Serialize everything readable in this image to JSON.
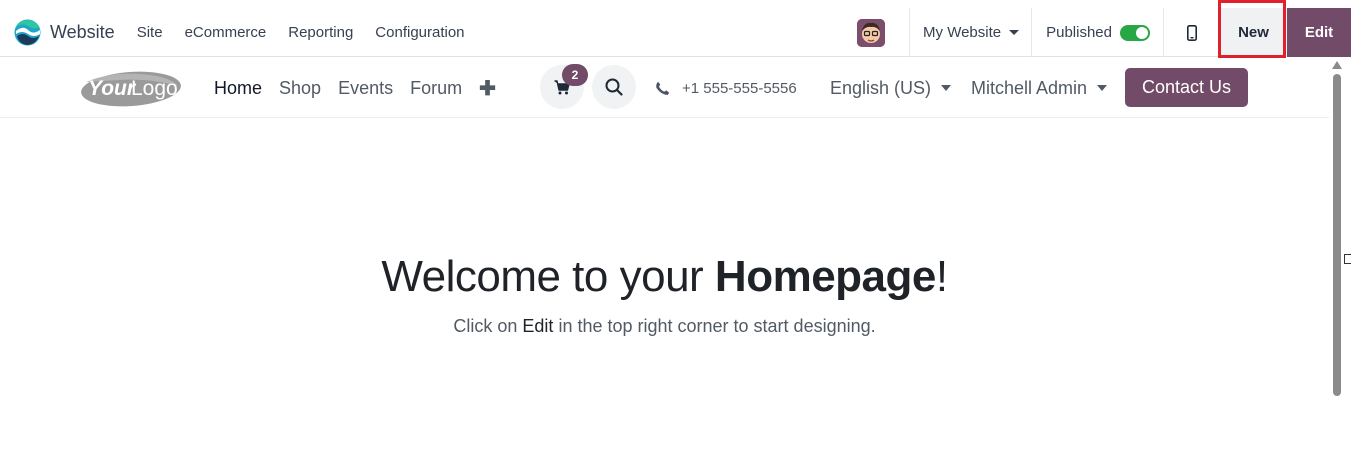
{
  "topbar": {
    "app_name": "Website",
    "menu": [
      "Site",
      "eCommerce",
      "Reporting",
      "Configuration"
    ],
    "website_selector": "My Website",
    "published_label": "Published",
    "published": true,
    "new_label": "New",
    "edit_label": "Edit"
  },
  "site_header": {
    "nav": [
      "Home",
      "Shop",
      "Events",
      "Forum"
    ],
    "active_nav": "Home",
    "cart_count": "2",
    "phone": "+1 555-555-5556",
    "language": "English (US)",
    "user": "Mitchell Admin",
    "contact_label": "Contact Us"
  },
  "hero": {
    "title_prefix": "Welcome to your ",
    "title_bold": "Homepage",
    "title_suffix": "!",
    "sub_prefix": "Click on ",
    "sub_em": "Edit",
    "sub_suffix": " in the top right corner to start designing."
  },
  "colors": {
    "brand": "#714b67",
    "toggle_on": "#28a745",
    "highlight": "#e0202b"
  }
}
